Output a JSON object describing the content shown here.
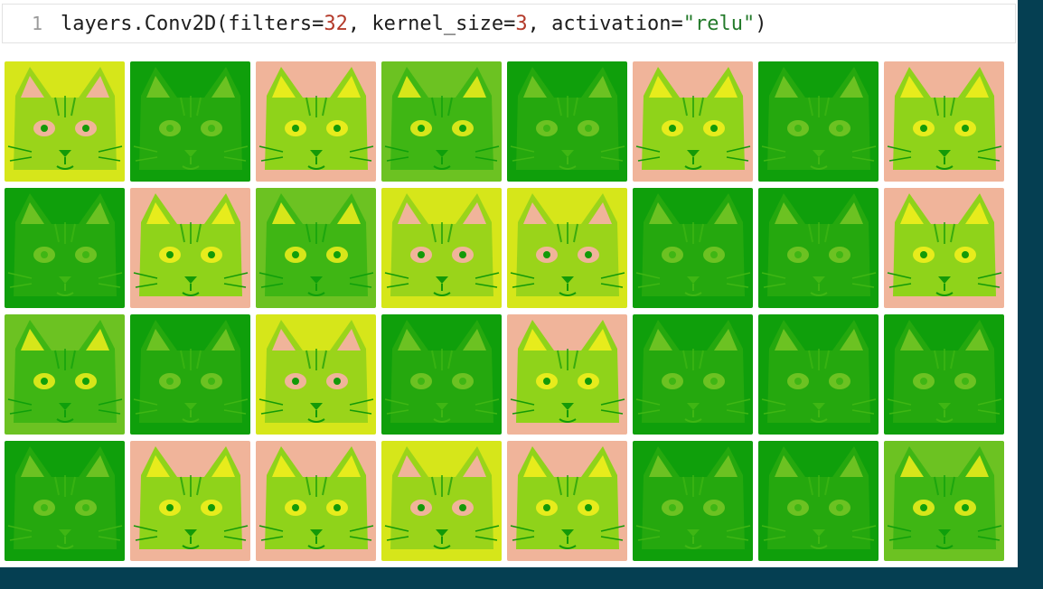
{
  "code": {
    "line_number": "1",
    "prefix": "layers.Conv2D(filters=",
    "filters_value": "32",
    "mid1": ", kernel_size=",
    "kernel_value": "3",
    "mid2": ", activation=",
    "activation_value": "\"relu\"",
    "suffix": ")"
  },
  "feature_maps": {
    "rows": 4,
    "cols": 8,
    "palettes": {
      "salmon": {
        "bg": "#f0b49a",
        "face": "#8fd31a",
        "mark": "#e7ec1c",
        "line": "#149a08"
      },
      "yellow": {
        "bg": "#d6e61a",
        "face": "#9ad41a",
        "mark": "#f0b49a",
        "line": "#139a08"
      },
      "green": {
        "bg": "#0f9f0b",
        "face": "#25a80e",
        "mark": "#6cc222",
        "line": "#3fb614"
      },
      "mixed": {
        "bg": "#6cc222",
        "face": "#3fb614",
        "mark": "#d6e61a",
        "line": "#0f9f0b"
      }
    },
    "tiles": [
      "yellow",
      "green",
      "salmon",
      "mixed",
      "green",
      "salmon",
      "green",
      "salmon",
      "green",
      "salmon",
      "mixed",
      "yellow",
      "yellow",
      "green",
      "green",
      "salmon",
      "mixed",
      "green",
      "yellow",
      "green",
      "salmon",
      "green",
      "green",
      "green",
      "green",
      "salmon",
      "salmon",
      "yellow",
      "salmon",
      "green",
      "green",
      "mixed"
    ]
  }
}
